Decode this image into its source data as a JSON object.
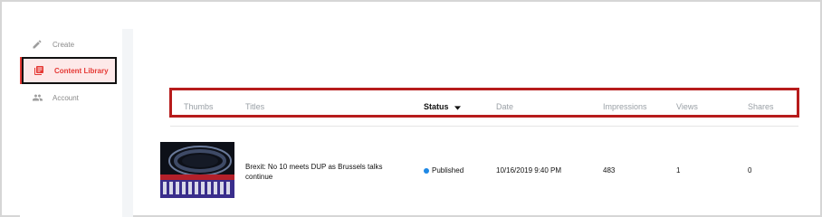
{
  "sidebar": {
    "items": [
      {
        "label": "Create",
        "icon": "pencil-icon"
      },
      {
        "label": "Content Library",
        "icon": "library-icon",
        "active": true
      },
      {
        "label": "Account",
        "icon": "people-icon"
      }
    ]
  },
  "table": {
    "columns": {
      "thumbs": "Thumbs",
      "titles": "Titles",
      "status": "Status",
      "date": "Date",
      "impressions": "Impressions",
      "views": "Views",
      "shares": "Shares"
    },
    "rows": [
      {
        "title": "Brexit: No 10 meets DUP as Brussels talks continue",
        "status": "Published",
        "date": "10/16/2019 9:40 PM",
        "impressions": "483",
        "views": "1",
        "shares": "0"
      }
    ]
  },
  "colors": {
    "accent": "#e53935",
    "active_bg": "#fde9e9",
    "status_published": "#1e88e5",
    "highlight_border": "#b71c1c"
  }
}
